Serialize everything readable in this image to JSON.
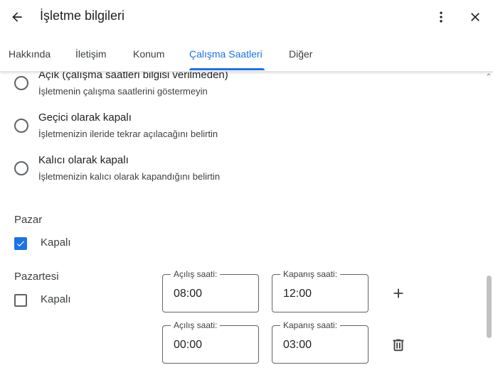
{
  "header": {
    "title": "İşletme bilgileri",
    "back_icon": "arrow-left-icon",
    "more_icon": "more-vert-icon",
    "close_icon": "close-icon"
  },
  "tabs": [
    {
      "label": "Hakkında",
      "active": false
    },
    {
      "label": "İletişim",
      "active": false
    },
    {
      "label": "Konum",
      "active": false
    },
    {
      "label": "Çalışma Saatleri",
      "active": true
    },
    {
      "label": "Diğer",
      "active": false
    }
  ],
  "status_options": [
    {
      "title": "Açık (çalışma saatleri bilgisi verilmeden)",
      "description": "İşletmenin çalışma saatlerini göstermeyin",
      "selected": false
    },
    {
      "title": "Geçici olarak kapalı",
      "description": "İşletmenizin ileride tekrar açılacağını belirtin",
      "selected": false
    },
    {
      "title": "Kalıcı olarak kapalı",
      "description": "İşletmenizin kalıcı olarak kapandığını belirtin",
      "selected": false
    }
  ],
  "days": {
    "sunday": {
      "name": "Pazar",
      "closed_label": "Kapalı",
      "closed": true
    },
    "monday": {
      "name": "Pazartesi",
      "closed_label": "Kapalı",
      "closed": false,
      "ranges": [
        {
          "open_label": "Açılış saati:",
          "open": "08:00",
          "close_label": "Kapanış saati:",
          "close": "12:00"
        },
        {
          "open_label": "Açılış saati:",
          "open": "00:00",
          "close_label": "Kapanış saati:",
          "close": "03:00"
        }
      ]
    }
  },
  "colors": {
    "accent": "#1a73e8",
    "text_primary": "#202124",
    "text_secondary": "#3c4043",
    "border": "#5f6368"
  }
}
